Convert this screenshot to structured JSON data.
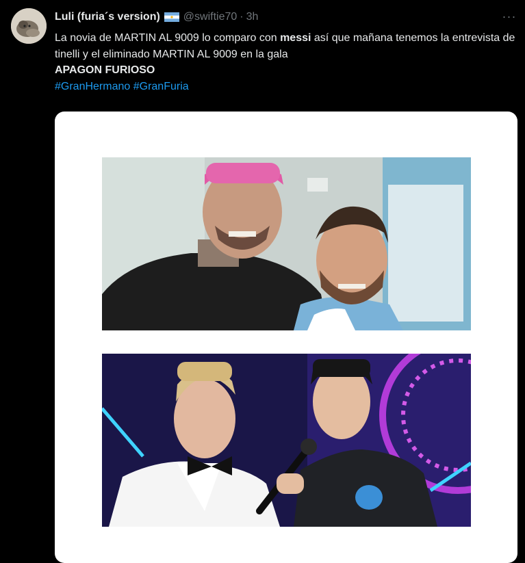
{
  "tweet": {
    "author_name": "Luli (furia´s version)",
    "author_flag": "argentina-flag-icon",
    "handle": "@swiftie70",
    "separator": "·",
    "time": "3h",
    "more_label": "···",
    "text": {
      "part1": "La novia de MARTIN AL 9009 lo comparo con ",
      "bold1": "messi",
      "part2": " así que mañana tenemos la entrevista de tinelli y el eliminado MARTIN AL 9009 en la gala",
      "bold2": "APAGON FURIOSO"
    },
    "hashtags": [
      "#GranHermano",
      "#GranFuria"
    ]
  },
  "media": {
    "photos": [
      {
        "icon": "photo-two-men-selfie"
      },
      {
        "icon": "photo-tv-show-stage"
      }
    ]
  },
  "colors": {
    "background": "#000000",
    "text": "#e7e9ea",
    "secondary": "#71767b",
    "link": "#1d9bf0",
    "media_bg": "#ffffff"
  }
}
